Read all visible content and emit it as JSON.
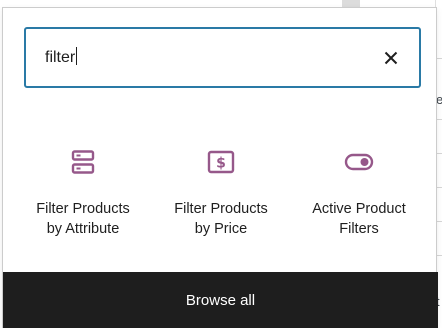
{
  "search": {
    "value": "filter",
    "clear_icon": "close-icon"
  },
  "results": [
    {
      "label": "Filter Products\nby Attribute",
      "icon": "filter-attribute-icon"
    },
    {
      "label": "Filter Products\nby Price",
      "icon": "filter-price-icon"
    },
    {
      "label": "Active Product\nFilters",
      "icon": "toggle-filters-icon"
    }
  ],
  "footer": {
    "browse_all_label": "Browse all"
  },
  "background": {
    "fragment_e": "e",
    "fragment_t": "t"
  },
  "colors": {
    "accent": "#2a7aa6",
    "icon": "#96588a",
    "footer_bg": "#1e1e1e",
    "text": "#1e1e1e"
  }
}
